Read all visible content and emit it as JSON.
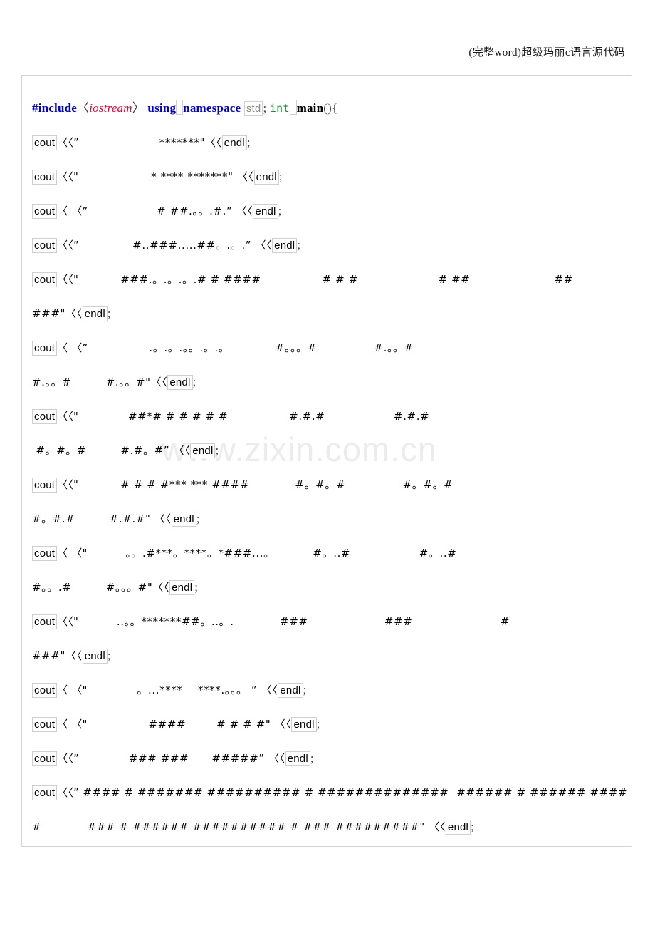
{
  "header": {
    "title": "(完整word)超级玛丽c语言源代码"
  },
  "watermark": {
    "text": "www.zixin.com.cn",
    "color": "#ececec"
  },
  "colors": {
    "preprocessor": "#0000c8",
    "header_include": "#dd0033",
    "keyword": "#0000c8",
    "type": "#1f8a3b",
    "namespace": "#8a8a8a",
    "function": "#000000",
    "field_shading_border": "#cfcfcf",
    "frame_border": "#d4d4d4"
  },
  "code": {
    "line1": {
      "preprocessor": "#include",
      "open_angle": "〈",
      "header": "iostream",
      "close_angle": "〉",
      "using": "using",
      "namespace_kw": "namespace",
      "std": "std",
      "semicolon": ";",
      "int": "int",
      "main": "main",
      "parens_brace": "(){"
    },
    "lines": [
      {
        "id": "line-2",
        "cout": "cout",
        "shift": "〈〈”",
        "body": "                     *******\"〈〈",
        "endl": "endl",
        "terminator": ";"
      },
      {
        "id": "line-3",
        "cout": "cout",
        "shift": "〈〈\"",
        "body": "                   * **** *******\" 〈〈",
        "endl": "endl",
        "terminator": ";"
      },
      {
        "id": "line-4",
        "cout": "cout",
        "shift": "〈 〈”",
        "body": "                  # ##.。。.#.” 〈〈",
        "endl": "endl",
        "terminator": ";"
      },
      {
        "id": "line-5",
        "cout": "cout",
        "shift": "〈〈”",
        "body": "              #..###.....##。.。.” 〈〈",
        "endl": "endl",
        "terminator": ";"
      },
      {
        "id": "line-6",
        "cout": "cout",
        "shift": "〈〈\"",
        "body": "           ###.。.。.。.# # ####                # # #                     # ##                      ##",
        "endl": null,
        "terminator": null,
        "continuation": {
          "body": "###\"〈〈",
          "endl": "endl",
          "terminator": ";"
        }
      },
      {
        "id": "line-7",
        "cout": "cout",
        "shift": "〈 〈”",
        "body": "                .。.。.。。.。.。            #。。。#               #.。。#",
        "endl": null,
        "terminator": null,
        "continuation": {
          "body": "#.。。#         #.。。#\"〈〈",
          "endl": "endl",
          "terminator": ";"
        }
      },
      {
        "id": "line-8",
        "cout": "cout",
        "shift": "〈〈\"",
        "body": "             ##*# # # # # #                #.#.#                  #.#.#",
        "endl": null,
        "terminator": null,
        "continuation": {
          "body": " #。#。#         #.#。#” 〈〈",
          "endl": "endl",
          "terminator": ";"
        }
      },
      {
        "id": "line-9",
        "cout": "cout",
        "shift": "〈〈\"",
        "body": "           # # # #*** *** ####            #。#。#               #。#。#",
        "endl": null,
        "terminator": null,
        "continuation": {
          "body": "#。#.#         #.#.#\" 〈〈",
          "endl": "endl",
          "terminator": ";"
        }
      },
      {
        "id": "line-10",
        "cout": "cout",
        "shift": "〈 〈\"",
        "body": "          。。.#***。****。*###...。          #。..#                  #。..#",
        "endl": null,
        "terminator": null,
        "continuation": {
          "body": "#。。.#         #。。。#\"〈〈",
          "endl": "endl",
          "terminator": ";"
        }
      },
      {
        "id": "line-11",
        "cout": "cout",
        "shift": "〈〈\"",
        "body": "          ..。。*******##。..。.            ###                    ###                       #",
        "endl": null,
        "terminator": null,
        "continuation": {
          "body": "###\"〈〈",
          "endl": "endl",
          "terminator": ";"
        }
      },
      {
        "id": "line-12",
        "cout": "cout",
        "shift": "〈 〈\"",
        "body": "             。...****    ****.。。。 ” 〈〈",
        "endl": "endl",
        "terminator": ";"
      },
      {
        "id": "line-13",
        "cout": "cout",
        "shift": "〈 〈\"",
        "body": "                ####        # # # #\" 〈〈",
        "endl": "endl",
        "terminator": ";"
      },
      {
        "id": "line-14",
        "cout": "cout",
        "shift": "〈〈”",
        "body": "             ### ###      #####” 〈〈",
        "endl": "endl",
        "terminator": ";"
      },
      {
        "id": "line-15",
        "cout": "cout",
        "shift": "〈〈”",
        "body": " #### # ####### ########## # ##############  ###### # ###### #### ### # ##",
        "endl": null,
        "terminator": null,
        "continuation": {
          "body": "#            ### # ###### ########## # ### #########\" 〈〈",
          "endl": "endl",
          "terminator": ";"
        }
      }
    ]
  }
}
